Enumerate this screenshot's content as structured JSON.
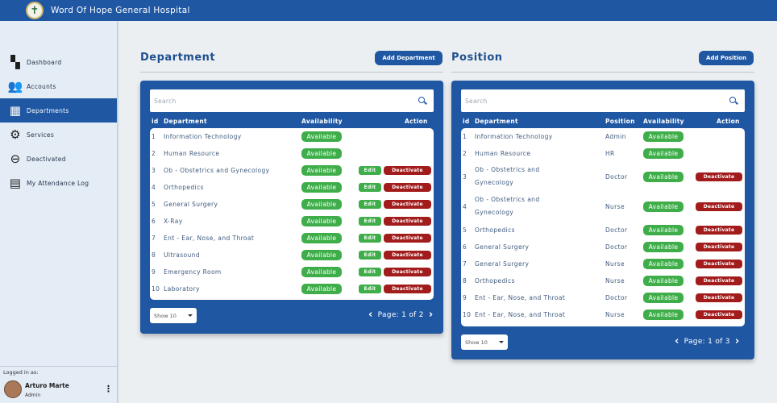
{
  "app": {
    "title": "Word Of Hope General Hospital",
    "logo_icon": "hospital-cross-logo"
  },
  "sidebar": {
    "items": [
      {
        "label": "Dashboard",
        "icon": "dashboard-icon",
        "active": false
      },
      {
        "label": "Accounts",
        "icon": "users-icon",
        "active": false
      },
      {
        "label": "Departments",
        "icon": "building-icon",
        "active": true
      },
      {
        "label": "Services",
        "icon": "gears-icon",
        "active": false
      },
      {
        "label": "Deactivated",
        "icon": "user-minus-icon",
        "active": false
      },
      {
        "label": "My Attendance Log",
        "icon": "log-icon",
        "active": false
      }
    ],
    "logged_in_label": "Logged in as:",
    "user": {
      "name": "Arturo Marte",
      "role": "Admin"
    }
  },
  "department": {
    "title": "Department",
    "add_label": "Add Department",
    "search_placeholder": "Search",
    "headers": {
      "id": "id",
      "name": "Department",
      "availability": "Availability",
      "action": "Action"
    },
    "rows": [
      {
        "id": "1",
        "name": "Information Technology",
        "availability": "Available",
        "edit": "",
        "deactivate": ""
      },
      {
        "id": "2",
        "name": "Human Resource",
        "availability": "Available",
        "edit": "",
        "deactivate": ""
      },
      {
        "id": "3",
        "name": "Ob - Obstetrics and Gynecology",
        "availability": "Available",
        "edit": "Edit",
        "deactivate": "Deactivate"
      },
      {
        "id": "4",
        "name": "Orthopedics",
        "availability": "Available",
        "edit": "Edit",
        "deactivate": "Deactivate"
      },
      {
        "id": "5",
        "name": "General Surgery",
        "availability": "Available",
        "edit": "Edit",
        "deactivate": "Deactivate"
      },
      {
        "id": "6",
        "name": "X-Ray",
        "availability": "Available",
        "edit": "Edit",
        "deactivate": "Deactivate"
      },
      {
        "id": "7",
        "name": "Ent - Ear, Nose, and Throat",
        "availability": "Available",
        "edit": "Edit",
        "deactivate": "Deactivate"
      },
      {
        "id": "8",
        "name": "Ultrasound",
        "availability": "Available",
        "edit": "Edit",
        "deactivate": "Deactivate"
      },
      {
        "id": "9",
        "name": "Emergency Room",
        "availability": "Available",
        "edit": "Edit",
        "deactivate": "Deactivate"
      },
      {
        "id": "10",
        "name": "Laboratory",
        "availability": "Available",
        "edit": "Edit",
        "deactivate": "Deactivate"
      }
    ],
    "show": "Show 10",
    "page_text": "Page: 1 of 2"
  },
  "position": {
    "title": "Position",
    "add_label": "Add Position",
    "search_placeholder": "Search",
    "headers": {
      "id": "id",
      "department": "Department",
      "position": "Position",
      "availability": "Availability",
      "action": "Action"
    },
    "rows": [
      {
        "id": "1",
        "line1": "Information Technology",
        "line2": "",
        "position": "Admin",
        "availability": "Available",
        "deactivate": ""
      },
      {
        "id": "2",
        "line1": "Human Resource",
        "line2": "",
        "position": "HR",
        "availability": "Available",
        "deactivate": ""
      },
      {
        "id": "3",
        "line1": "Ob - Obstetrics and",
        "line2": "Gynecology",
        "position": "Doctor",
        "availability": "Available",
        "deactivate": "Deactivate"
      },
      {
        "id": "4",
        "line1": "Ob - Obstetrics and",
        "line2": "Gynecology",
        "position": "Nurse",
        "availability": "Available",
        "deactivate": "Deactivate"
      },
      {
        "id": "5",
        "line1": "Orthopedics",
        "line2": "",
        "position": "Doctor",
        "availability": "Available",
        "deactivate": "Deactivate"
      },
      {
        "id": "6",
        "line1": "General Surgery",
        "line2": "",
        "position": "Doctor",
        "availability": "Available",
        "deactivate": "Deactivate"
      },
      {
        "id": "7",
        "line1": "General Surgery",
        "line2": "",
        "position": "Nurse",
        "availability": "Available",
        "deactivate": "Deactivate"
      },
      {
        "id": "8",
        "line1": "Orthopedics",
        "line2": "",
        "position": "Nurse",
        "availability": "Available",
        "deactivate": "Deactivate"
      },
      {
        "id": "9",
        "line1": "Ent - Ear, Nose, and Throat",
        "line2": "",
        "position": "Doctor",
        "availability": "Available",
        "deactivate": "Deactivate"
      },
      {
        "id": "10",
        "line1": "Ent - Ear, Nose, and Throat",
        "line2": "",
        "position": "Nurse",
        "availability": "Available",
        "deactivate": "Deactivate"
      }
    ],
    "show": "Show 10",
    "page_text": "Page: 1 of 3"
  },
  "colors": {
    "primary": "#1f57a3",
    "available": "#3fae4a",
    "deactivate": "#a31c1c",
    "background": "#eceff2"
  }
}
